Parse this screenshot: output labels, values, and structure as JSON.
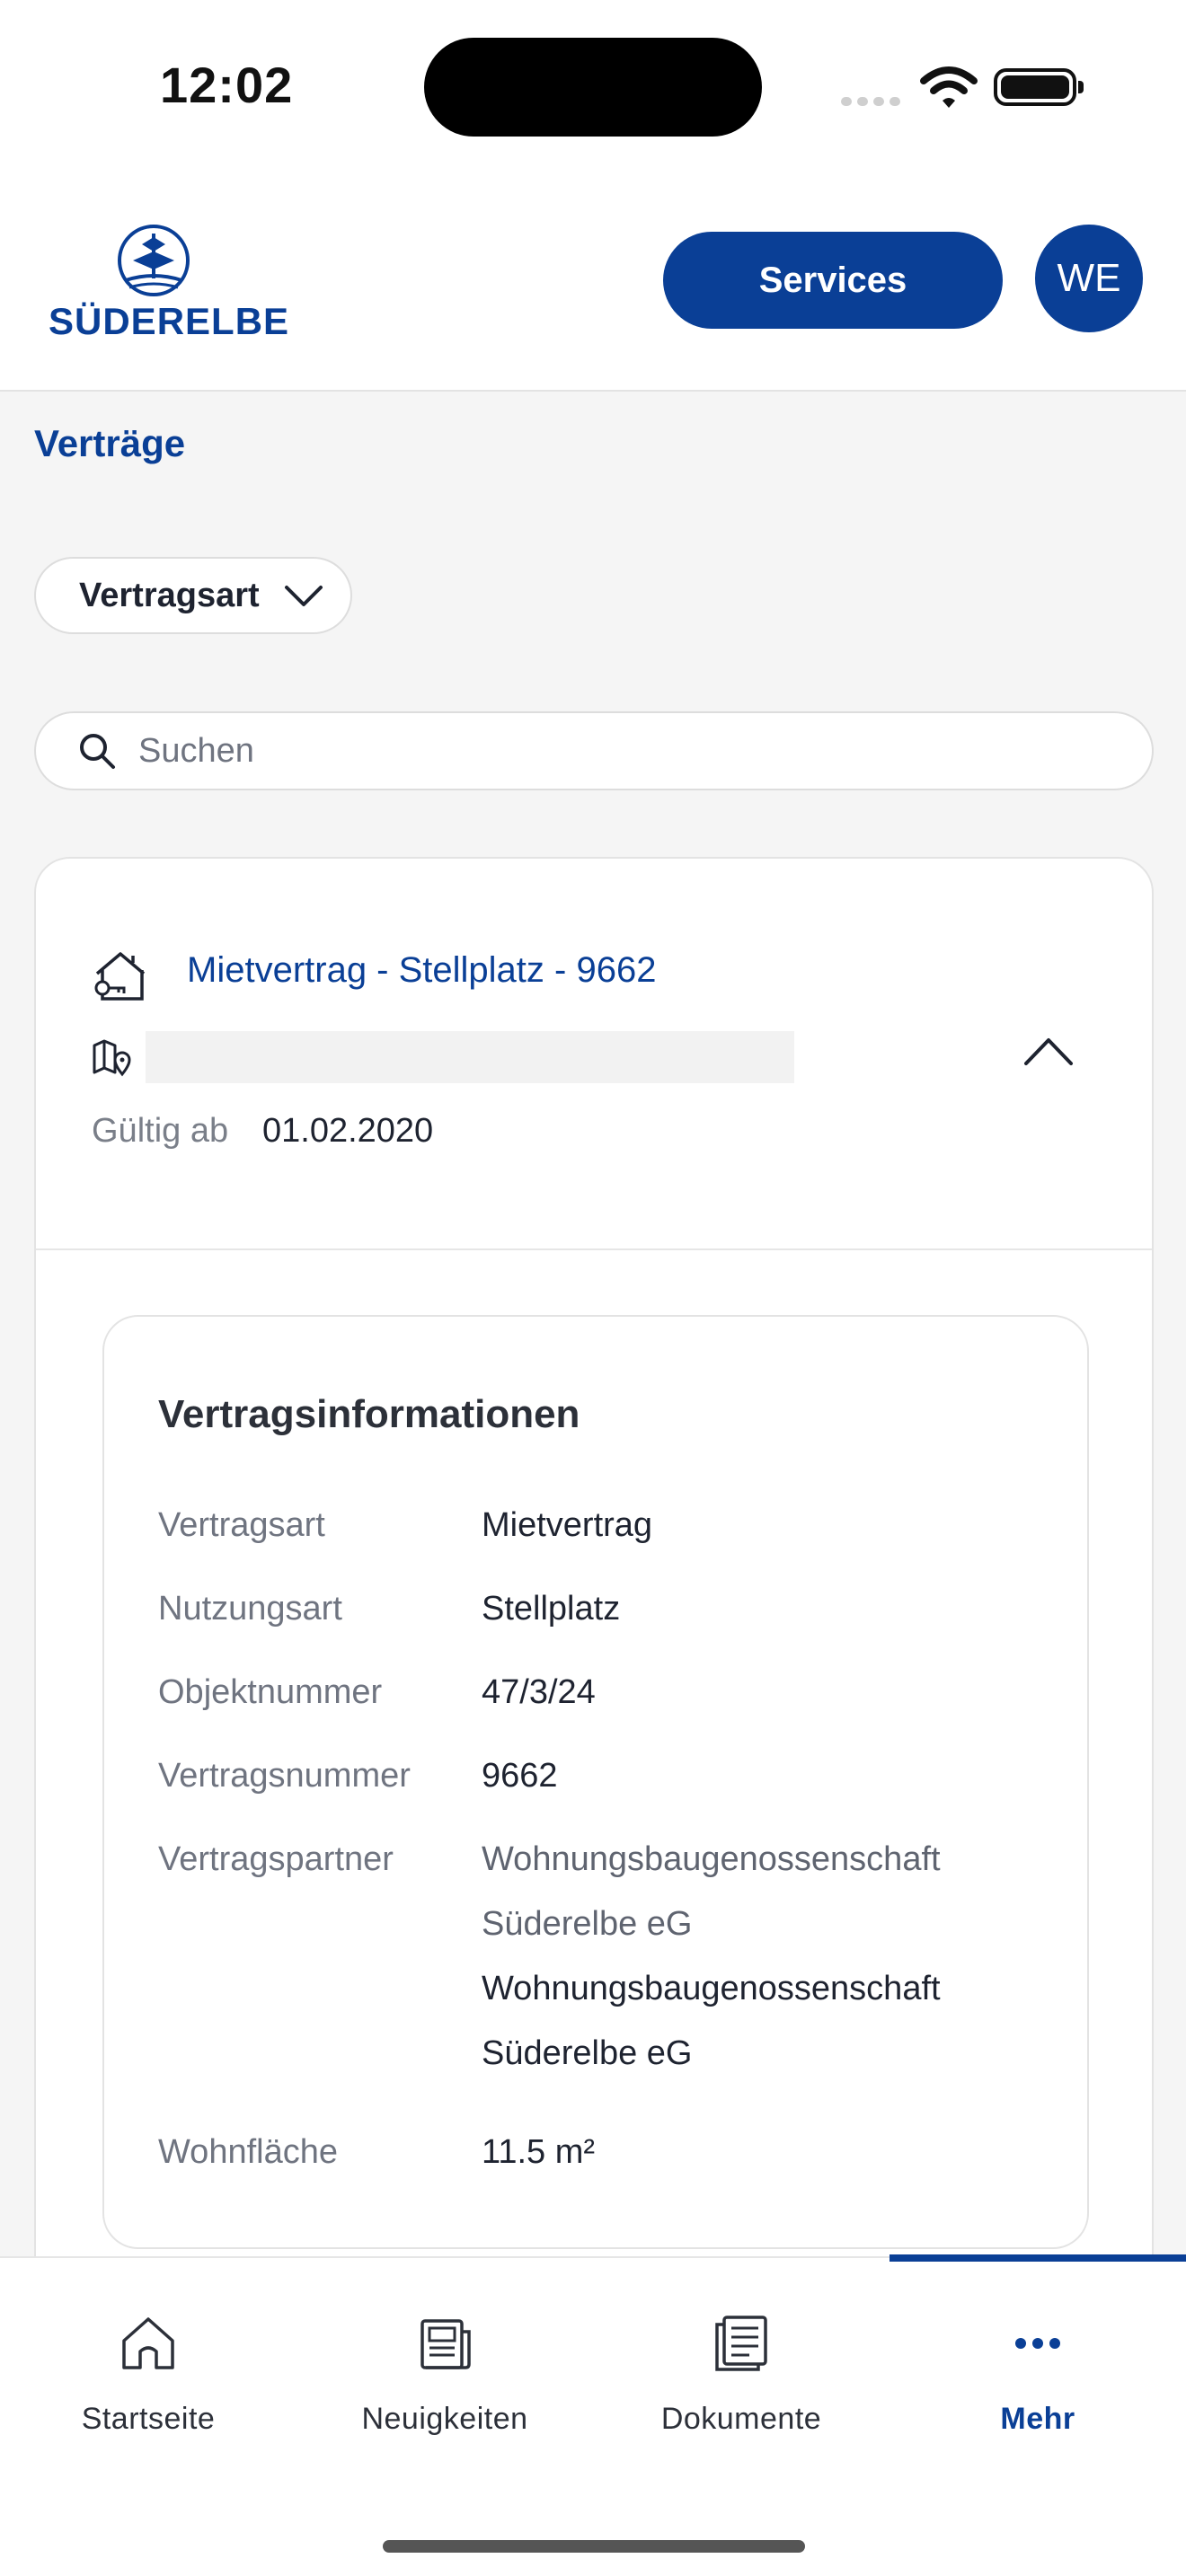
{
  "status_bar": {
    "time": "12:02"
  },
  "header": {
    "logo_text": "SÜDERELBE",
    "services_label": "Services",
    "avatar_initials": "WE"
  },
  "page": {
    "title": "Verträge"
  },
  "filter": {
    "label": "Vertragsart"
  },
  "search": {
    "placeholder": "Suchen"
  },
  "contract": {
    "title": "Mietvertrag - Stellplatz - 9662",
    "valid_label": "Gültig ab",
    "valid_value": "01.02.2020",
    "info": {
      "title": "Vertragsinformationen",
      "rows": [
        {
          "label": "Vertragsart",
          "value": "Mietvertrag"
        },
        {
          "label": "Nutzungsart",
          "value": "Stellplatz"
        },
        {
          "label": "Objektnummer",
          "value": "47/3/24"
        },
        {
          "label": "Vertragsnummer",
          "value": "9662"
        },
        {
          "label": "Vertragspartner",
          "value_line1": "Wohnungsbaugenossenschaft",
          "value_line2": "Süderelbe eG",
          "value_line3": "Wohnungsbaugenossenschaft",
          "value_line4": "Süderelbe eG"
        },
        {
          "label": "Wohnfläche",
          "value": "11.5 m²"
        }
      ]
    }
  },
  "bottom_nav": {
    "items": [
      {
        "label": "Startseite",
        "icon": "home-icon"
      },
      {
        "label": "Neuigkeiten",
        "icon": "news-icon"
      },
      {
        "label": "Dokumente",
        "icon": "document-icon"
      },
      {
        "label": "Mehr",
        "icon": "more-icon",
        "active": true
      }
    ]
  },
  "colors": {
    "brand": "#0a3f96",
    "background": "#f5f5f5"
  }
}
